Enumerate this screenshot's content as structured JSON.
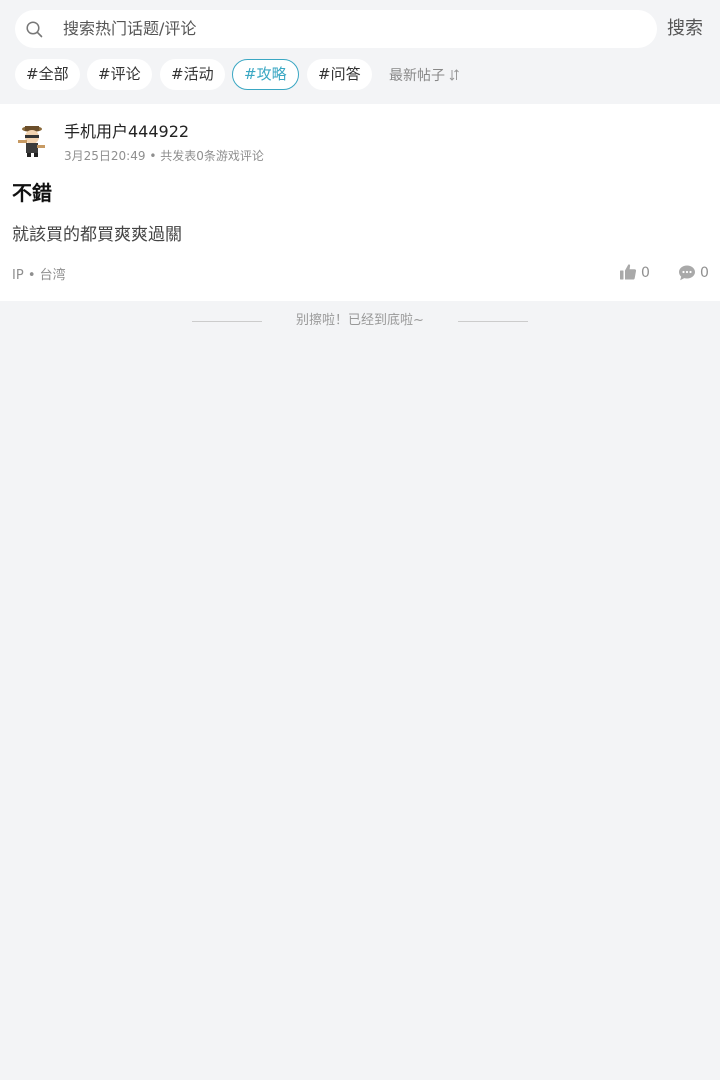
{
  "search": {
    "placeholder": "搜索热门话题/评论",
    "button_label": "搜索"
  },
  "tags": [
    {
      "label": "#全部",
      "active": false
    },
    {
      "label": "#评论",
      "active": false
    },
    {
      "label": "#活动",
      "active": false
    },
    {
      "label": "#攻略",
      "active": true
    },
    {
      "label": "#问答",
      "active": false
    }
  ],
  "sort": {
    "label": "最新帖子",
    "icon": "sort-arrows-icon"
  },
  "post": {
    "username": "手机用户444922",
    "timestamp": "3月25日20:49",
    "stats": "共发表0条游戏评论",
    "title": "不錯",
    "content": "就該買的都買爽爽過關",
    "ip_label": "IP",
    "ip_location": "台湾",
    "likes": "0",
    "comments": "0",
    "like_icon": "thumbs-up-icon",
    "comment_icon": "comment-bubble-icon"
  },
  "end_note": "别擦啦！已经到底啦~",
  "colors": {
    "accent": "#3aa7c3",
    "background": "#f3f4f6",
    "muted": "#8f8f8f"
  }
}
